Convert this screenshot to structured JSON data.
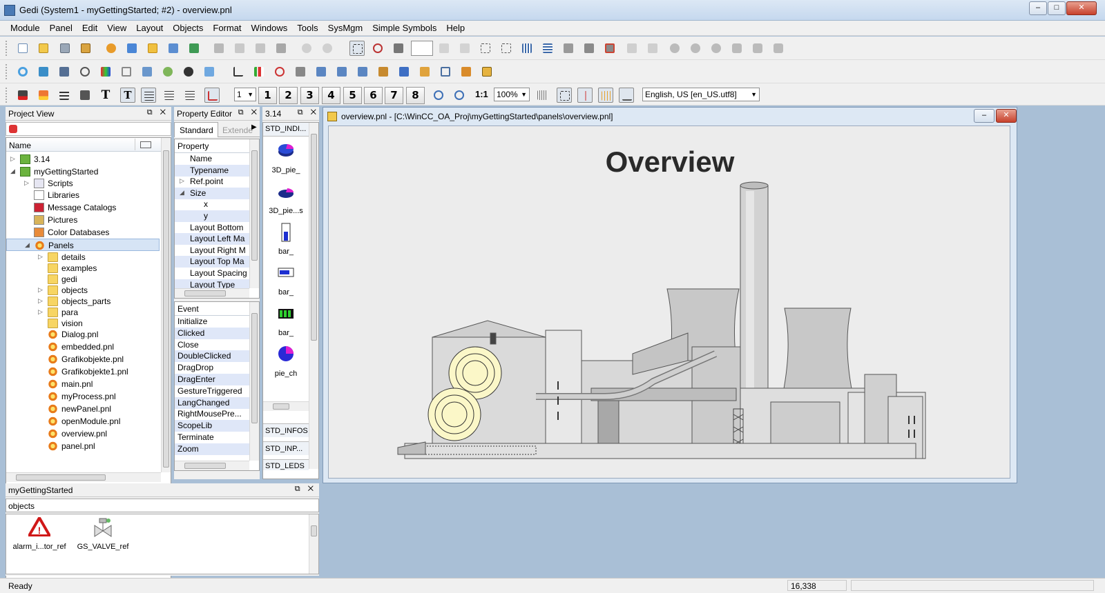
{
  "window": {
    "title": "Gedi (System1 - myGettingStarted; #2) - overview.pnl",
    "min": "–",
    "max": "□",
    "close": "✕"
  },
  "menu": [
    "Module",
    "Panel",
    "Edit",
    "View",
    "Layout",
    "Objects",
    "Format",
    "Windows",
    "Tools",
    "SysMgm",
    "Simple Symbols",
    "Help"
  ],
  "toolbar3": {
    "line_width": "1",
    "numbers": [
      "1",
      "2",
      "3",
      "4",
      "5",
      "6",
      "7",
      "8"
    ],
    "ratio": "1:1",
    "zoom": "100%",
    "language": "English, US [en_US.utf8]",
    "text_tool": "T"
  },
  "project_view": {
    "title": "Project View",
    "column": "Name",
    "items": [
      {
        "label": "3.14",
        "icon": "project-icon",
        "level": 0,
        "exp": "▷"
      },
      {
        "label": "myGettingStarted",
        "icon": "project-icon",
        "level": 0,
        "exp": "◢"
      },
      {
        "label": "Scripts",
        "icon": "script-icon",
        "level": 1,
        "exp": "▷"
      },
      {
        "label": "Libraries",
        "icon": "library-icon",
        "level": 1,
        "exp": ""
      },
      {
        "label": "Message Catalogs",
        "icon": "catalog-icon",
        "level": 1,
        "exp": ""
      },
      {
        "label": "Pictures",
        "icon": "picture-icon",
        "level": 1,
        "exp": ""
      },
      {
        "label": "Color Databases",
        "icon": "palette-icon",
        "level": 1,
        "exp": ""
      },
      {
        "label": "Panels",
        "icon": "panel-icon",
        "level": 1,
        "exp": "◢",
        "selected": true
      },
      {
        "label": "details",
        "icon": "folder-icon",
        "level": 2,
        "exp": "▷"
      },
      {
        "label": "examples",
        "icon": "folder-icon",
        "level": 2,
        "exp": ""
      },
      {
        "label": "gedi",
        "icon": "folder-icon",
        "level": 2,
        "exp": ""
      },
      {
        "label": "objects",
        "icon": "folder-icon",
        "level": 2,
        "exp": "▷"
      },
      {
        "label": "objects_parts",
        "icon": "folder-icon",
        "level": 2,
        "exp": "▷"
      },
      {
        "label": "para",
        "icon": "folder-icon",
        "level": 2,
        "exp": "▷"
      },
      {
        "label": "vision",
        "icon": "folder-icon",
        "level": 2,
        "exp": ""
      },
      {
        "label": "Dialog.pnl",
        "icon": "pnl-icon",
        "level": 2,
        "exp": ""
      },
      {
        "label": "embedded.pnl",
        "icon": "pnl-icon",
        "level": 2,
        "exp": ""
      },
      {
        "label": "Grafikobjekte.pnl",
        "icon": "pnl-icon",
        "level": 2,
        "exp": ""
      },
      {
        "label": "Grafikobjekte1.pnl",
        "icon": "pnl-icon",
        "level": 2,
        "exp": ""
      },
      {
        "label": "main.pnl",
        "icon": "pnl-icon",
        "level": 2,
        "exp": ""
      },
      {
        "label": "myProcess.pnl",
        "icon": "pnl-icon",
        "level": 2,
        "exp": ""
      },
      {
        "label": "newPanel.pnl",
        "icon": "pnl-icon",
        "level": 2,
        "exp": ""
      },
      {
        "label": "openModule.pnl",
        "icon": "pnl-icon",
        "level": 2,
        "exp": ""
      },
      {
        "label": "overview.pnl",
        "icon": "pnl-icon",
        "level": 2,
        "exp": ""
      },
      {
        "label": "panel.pnl",
        "icon": "pnl-icon",
        "level": 2,
        "exp": ""
      }
    ]
  },
  "property_editor": {
    "title": "Property Editor",
    "tabs": [
      "Standard",
      "Extended"
    ],
    "column": "Property",
    "rows": [
      {
        "label": "Name",
        "indent": 1,
        "exp": ""
      },
      {
        "label": "Typename",
        "indent": 1,
        "exp": ""
      },
      {
        "label": "Ref.point",
        "indent": 1,
        "exp": "▷"
      },
      {
        "label": "Size",
        "indent": 1,
        "exp": "◢"
      },
      {
        "label": "x",
        "indent": 2,
        "exp": ""
      },
      {
        "label": "y",
        "indent": 2,
        "exp": ""
      },
      {
        "label": "Layout Bottom",
        "indent": 1,
        "exp": ""
      },
      {
        "label": "Layout Left Ma",
        "indent": 1,
        "exp": ""
      },
      {
        "label": "Layout Right M",
        "indent": 1,
        "exp": ""
      },
      {
        "label": "Layout Top Ma",
        "indent": 1,
        "exp": ""
      },
      {
        "label": "Layout Spacing",
        "indent": 1,
        "exp": ""
      },
      {
        "label": "Layout Type",
        "indent": 1,
        "exp": ""
      }
    ],
    "event_column": "Event",
    "events": [
      "Initialize",
      "Clicked",
      "Close",
      "DoubleClicked",
      "DragDrop",
      "DragEnter",
      "GestureTriggered",
      "LangChanged",
      "RightMousePre...",
      "ScopeLib",
      "Terminate",
      "Zoom"
    ]
  },
  "catalog": {
    "title": "3.14",
    "group": "STD_INDI...",
    "symbols": [
      {
        "label": "3D_pie_",
        "icon": "pie3d-icon"
      },
      {
        "label": "3D_pie...s",
        "icon": "pie3d-small-icon"
      },
      {
        "label": "bar_",
        "icon": "bar-vertical-icon"
      },
      {
        "label": "bar_",
        "icon": "bar-horizontal-icon"
      },
      {
        "label": "bar_",
        "icon": "bar-green-icon"
      },
      {
        "label": "pie_ch",
        "icon": "pie-chart-icon"
      }
    ],
    "groups": [
      "STD_INFOS",
      "STD_INP...",
      "STD_LEDS"
    ]
  },
  "bottom_panel": {
    "title": "myGettingStarted",
    "section": "objects",
    "items": [
      {
        "label": "alarm_i...tor_ref",
        "icon": "alarm-warning-icon"
      },
      {
        "label": "GS_VALVE_ref",
        "icon": "valve-icon"
      }
    ]
  },
  "document": {
    "title": "overview.pnl - [C:\\WinCC_OA_Proj\\myGettingStarted\\panels\\overview.pnl]",
    "heading": "Overview"
  },
  "status": {
    "text": "Ready",
    "coords": "16,338"
  },
  "colors": {
    "accent": "#3d6fb6",
    "selection": "#d6e4f5",
    "alt_row": "#dfe7f8",
    "plant_gray": "#c8c8c8"
  }
}
